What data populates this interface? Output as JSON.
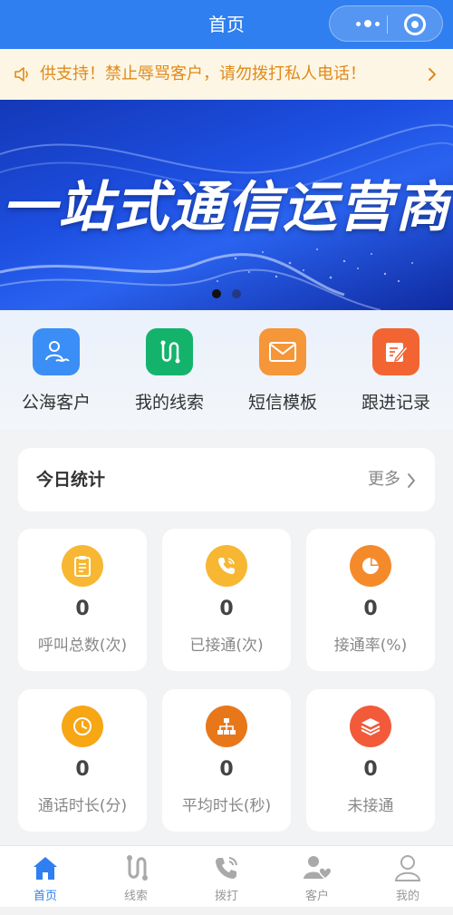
{
  "header": {
    "title": "首页"
  },
  "notice": {
    "text": "供支持！禁止辱骂客户，请勿拨打私人电话！"
  },
  "banner": {
    "headline": "一站式通信运营商",
    "active_index": 0,
    "count": 2
  },
  "quick_nav": [
    {
      "label": "公海客户",
      "icon": "sea-customer-icon",
      "color": "#3b8ef5"
    },
    {
      "label": "我的线索",
      "icon": "clue-icon",
      "color": "#14b36b"
    },
    {
      "label": "短信模板",
      "icon": "mail-icon",
      "color": "#f59638"
    },
    {
      "label": "跟进记录",
      "icon": "edit-record-icon",
      "color": "#f26533"
    }
  ],
  "stats_header": {
    "title": "今日统计",
    "more": "更多"
  },
  "stats": [
    {
      "value": "0",
      "label": "呼叫总数(次)",
      "icon": "clipboard-icon",
      "color": "#f7b733"
    },
    {
      "value": "0",
      "label": "已接通(次)",
      "icon": "phone-icon",
      "color": "#f7b733"
    },
    {
      "value": "0",
      "label": "接通率(%)",
      "icon": "pie-chart-icon",
      "color": "#f58a2b"
    },
    {
      "value": "0",
      "label": "通话时长(分)",
      "icon": "clock-icon",
      "color": "#f7a614"
    },
    {
      "value": "0",
      "label": "平均时长(秒)",
      "icon": "hierarchy-icon",
      "color": "#e8771a"
    },
    {
      "value": "0",
      "label": "未接通",
      "icon": "layers-icon",
      "color": "#f25a3a"
    }
  ],
  "tabbar": [
    {
      "label": "首页",
      "icon": "home-icon",
      "active": true
    },
    {
      "label": "线索",
      "icon": "clue-icon",
      "active": false
    },
    {
      "label": "拨打",
      "icon": "dial-icon",
      "active": false
    },
    {
      "label": "客户",
      "icon": "customer-icon",
      "active": false
    },
    {
      "label": "我的",
      "icon": "profile-icon",
      "active": false
    }
  ],
  "colors": {
    "primary": "#2f7ff0",
    "notice_text": "#e08a1a",
    "notice_bg": "#fdf6e4"
  }
}
